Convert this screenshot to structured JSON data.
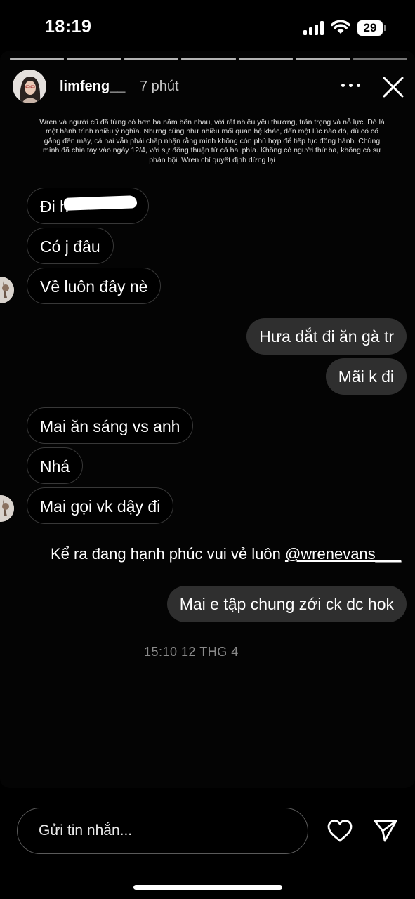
{
  "status_bar": {
    "time": "18:19",
    "battery": "29"
  },
  "story": {
    "progress_segments": 7,
    "username": "limfeng__",
    "time_ago": "7 phút",
    "caption": "Wren và người cũ đã từng có hơn ba năm bên nhau, với rất nhiều yêu thương, trân trọng và nỗ lực. Đó là một hành trình nhiều ý nghĩa. Nhưng cũng như nhiều mối quan hệ khác, đến một lúc nào đó, dù có cố gắng đến mấy, cả hai vẫn phải chấp nhận rằng mình không còn phù hợp để tiếp tục đồng hành. Chúng mình đã chia tay vào ngày 12/4, với sự đồng thuận từ cả hai phía. Không có người thứ ba, không có sự phản bội. Wren chỉ quyết định dừng lại",
    "messages": [
      {
        "text": "Đi h",
        "side": "received"
      },
      {
        "text": "Có j đâu",
        "side": "received"
      },
      {
        "text": "Về luôn đây nè",
        "side": "received"
      },
      {
        "text": "Hưa dắt đi ăn gà tr",
        "side": "sent"
      },
      {
        "text": "Mãi k đi",
        "side": "sent"
      },
      {
        "text": "Mai ăn sáng vs anh",
        "side": "received"
      },
      {
        "text": "Nhá",
        "side": "received"
      },
      {
        "text": "Mai gọi vk dậy đi",
        "side": "received"
      },
      {
        "text": "Mai e tập chung zới ck dc hok",
        "side": "sent"
      }
    ],
    "overlay_text": "Kể ra đang hạnh phúc vui vẻ luôn",
    "mention": "@wrenevans___",
    "timestamp": "15:10 12 THG 4"
  },
  "composer": {
    "placeholder": "Gửi tin nhắn...",
    "icons": [
      "heart-icon",
      "send-icon"
    ]
  },
  "colors": {
    "background": "#000000",
    "sent_bubble": "#2f2f2f",
    "received_border": "#383838",
    "timestamp": "#8a8a8a"
  }
}
